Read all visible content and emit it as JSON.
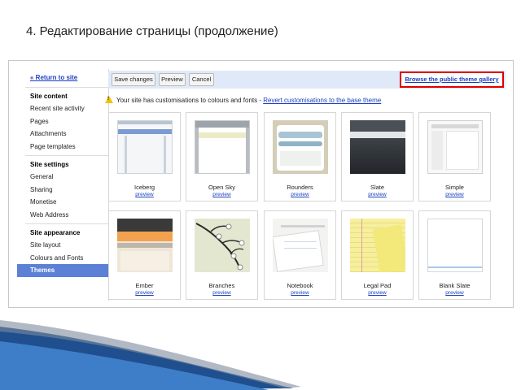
{
  "slide": {
    "title": "4. Редактирование страницы (продолжение)"
  },
  "sidebar": {
    "return_link": "« Return to site",
    "sections": [
      {
        "heading": "Site content",
        "items": [
          "Recent site activity",
          "Pages",
          "Attachments",
          "Page templates"
        ]
      },
      {
        "heading": "Site settings",
        "items": [
          "General",
          "Sharing",
          "Monetise",
          "Web Address"
        ]
      },
      {
        "heading": "Site appearance",
        "items": [
          "Site layout",
          "Colours and Fonts",
          "Themes"
        ]
      }
    ],
    "active_item": "Themes"
  },
  "toolbar": {
    "save_label": "Save changes",
    "preview_label": "Preview",
    "cancel_label": "Cancel",
    "browse_label": "Browse the public theme gallery"
  },
  "notice": {
    "text": "Your site has customisations to colours and fonts - ",
    "link": "Revert customisations to the base theme"
  },
  "themes": [
    {
      "name": "Iceberg",
      "preview": "preview"
    },
    {
      "name": "Open Sky",
      "preview": "preview"
    },
    {
      "name": "Rounders",
      "preview": "preview"
    },
    {
      "name": "Slate",
      "preview": "preview"
    },
    {
      "name": "Simple",
      "preview": "preview"
    },
    {
      "name": "Ember",
      "preview": "preview"
    },
    {
      "name": "Branches",
      "preview": "preview"
    },
    {
      "name": "Notebook",
      "preview": "preview"
    },
    {
      "name": "Legal Pad",
      "preview": "preview"
    },
    {
      "name": "Blank Slate",
      "preview": "preview"
    }
  ],
  "colors": {
    "accent": "#5b80d6",
    "link": "#1a3fbf",
    "highlight_border": "#e00000",
    "toolbar_bg": "#dfe9f8"
  }
}
